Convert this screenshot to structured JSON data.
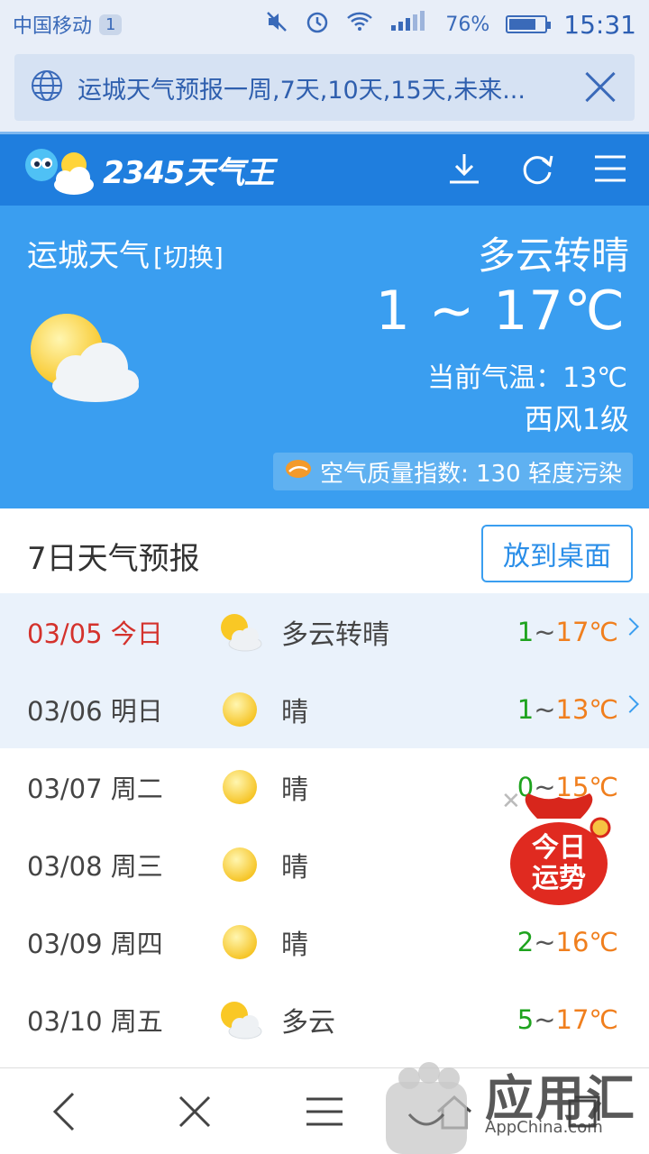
{
  "status_bar": {
    "carrier": "中国移动",
    "notification_count": "1",
    "battery": "76%",
    "battery_level": 0.76,
    "time": "15:31"
  },
  "url_bar": {
    "title": "运城天气预报一周,7天,10天,15天,未来..."
  },
  "app": {
    "logo_text": "2345天气王",
    "icons": [
      "download-icon",
      "refresh-icon",
      "menu-icon"
    ]
  },
  "current": {
    "city": "运城天气",
    "switch_label": "[切换]",
    "condition": "多云转晴",
    "range": "1 ~ 17℃",
    "current_temp": "当前气温：13℃",
    "wind": "西风1级",
    "aqi": "空气质量指数: 130 轻度污染"
  },
  "forecast": {
    "title": "7日天气预报",
    "pin_button": "放到桌面",
    "days": [
      {
        "date": "03/05 今日",
        "icon": "cloudy-sun-icon",
        "desc": "多云转晴",
        "lo": "1",
        "sep": "~",
        "hi": "17",
        "unit": "℃",
        "today": true,
        "highlight": true,
        "arrow": true
      },
      {
        "date": "03/06 明日",
        "icon": "sun-icon",
        "desc": "晴",
        "lo": "1",
        "sep": "~",
        "hi": "13",
        "unit": "℃",
        "today": false,
        "highlight": true,
        "arrow": true
      },
      {
        "date": "03/07 周二",
        "icon": "sun-icon",
        "desc": "晴",
        "lo": "0",
        "sep": "~",
        "hi": "15",
        "unit": "℃",
        "today": false,
        "highlight": false,
        "arrow": false
      },
      {
        "date": "03/08 周三",
        "icon": "sun-icon",
        "desc": "晴",
        "lo": "",
        "sep": "",
        "hi": "",
        "unit": "",
        "today": false,
        "highlight": false,
        "arrow": false
      },
      {
        "date": "03/09 周四",
        "icon": "sun-icon",
        "desc": "晴",
        "lo": "2",
        "sep": "~",
        "hi": "16",
        "unit": "℃",
        "today": false,
        "highlight": false,
        "arrow": false
      },
      {
        "date": "03/10 周五",
        "icon": "cloudy-sun-icon",
        "desc": "多云",
        "lo": "5",
        "sep": "~",
        "hi": "17",
        "unit": "℃",
        "today": false,
        "highlight": false,
        "arrow": false
      }
    ]
  },
  "fortune": {
    "line1": "今日",
    "line2": "运势"
  },
  "watermark": {
    "title": "应用汇",
    "sub": "AppChina.com"
  }
}
